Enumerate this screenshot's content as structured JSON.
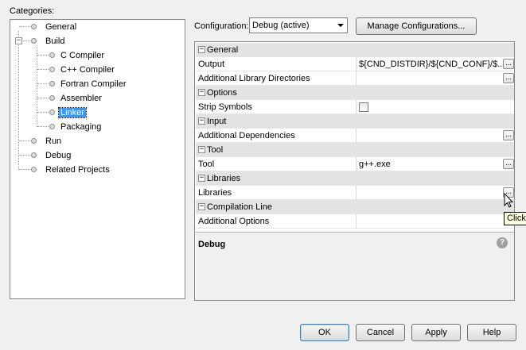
{
  "categories_label": "Categories:",
  "tree": {
    "general": "General",
    "build": "Build",
    "c_compiler": "C Compiler",
    "cpp_compiler": "C++ Compiler",
    "fortran_compiler": "Fortran Compiler",
    "assembler": "Assembler",
    "linker": "Linker",
    "packaging": "Packaging",
    "run": "Run",
    "debug": "Debug",
    "related_projects": "Related Projects"
  },
  "configuration": {
    "label": "Configuration:",
    "selected": "Debug (active)",
    "manage_label": "Manage Configurations..."
  },
  "properties": {
    "general_cat": "General",
    "output_name": "Output",
    "output_value": "${CND_DISTDIR}/${CND_CONF}/$...",
    "lib_dirs_name": "Additional Library Directories",
    "lib_dirs_value": "",
    "options_cat": "Options",
    "strip_name": "Strip Symbols",
    "strip_checked": false,
    "input_cat": "Input",
    "add_deps_name": "Additional Dependencies",
    "add_deps_value": "",
    "tool_cat": "Tool",
    "tool_name": "Tool",
    "tool_value": "g++.exe",
    "libraries_cat": "Libraries",
    "libraries_name": "Libraries",
    "libraries_value": "",
    "compilation_cat": "Compilation Line",
    "add_options_name": "Additional Options",
    "add_options_value": "",
    "ellipsis": "..."
  },
  "description": {
    "title": "Debug",
    "help_icon": "?"
  },
  "tooltip": "Click",
  "buttons": {
    "ok": "OK",
    "cancel": "Cancel",
    "apply": "Apply",
    "help": "Help"
  },
  "colors": {
    "selection": "#3399ff",
    "category_bg": "#e3e3e3",
    "window_bg": "#f0f0f0"
  }
}
